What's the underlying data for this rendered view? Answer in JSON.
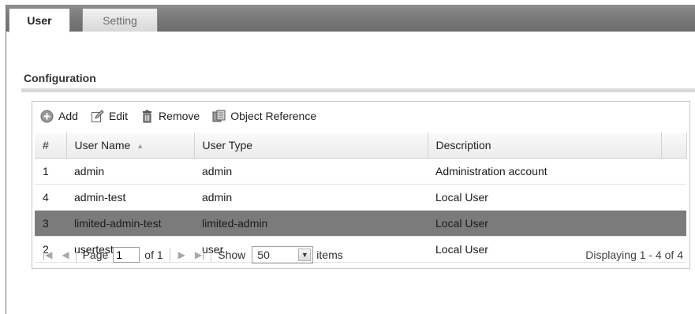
{
  "tabs": [
    {
      "label": "User",
      "active": true
    },
    {
      "label": "Setting",
      "active": false
    }
  ],
  "section": {
    "title": "Configuration"
  },
  "toolbar": {
    "add_label": "Add",
    "edit_label": "Edit",
    "remove_label": "Remove",
    "object_reference_label": "Object Reference"
  },
  "table": {
    "headers": {
      "index": "#",
      "user_name": "User Name",
      "user_type": "User Type",
      "description": "Description"
    },
    "sort": {
      "column": "User Name",
      "direction": "ascending"
    },
    "rows": [
      {
        "index": "1",
        "user_name": "admin",
        "user_type": "admin",
        "description": "Administration account",
        "selected": false
      },
      {
        "index": "4",
        "user_name": "admin-test",
        "user_type": "admin",
        "description": "Local User",
        "selected": false
      },
      {
        "index": "3",
        "user_name": "limited-admin-test",
        "user_type": "limited-admin",
        "description": "Local User",
        "selected": true
      },
      {
        "index": "2",
        "user_name": "usertest",
        "user_type": "user",
        "description": "Local User",
        "selected": false
      }
    ]
  },
  "pager": {
    "page_label": "Page",
    "page_value": "1",
    "of_label": "of 1",
    "show_label": "Show",
    "show_value": "50",
    "items_label": "items",
    "displaying": "Displaying 1 - 4 of 4"
  },
  "colors": {
    "selected_row": "#7b7b7b",
    "tabbar": "#7a7a7a"
  }
}
